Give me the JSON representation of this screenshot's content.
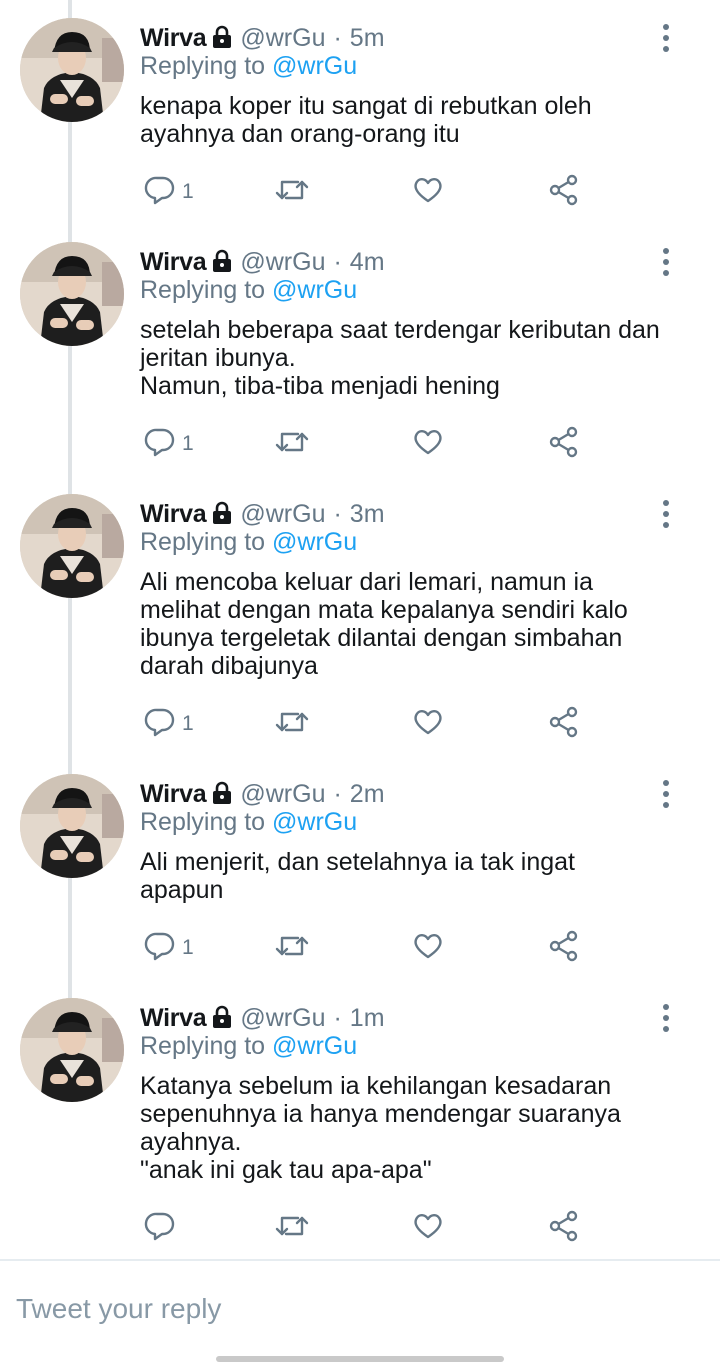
{
  "colors": {
    "accent": "#1da1f2",
    "secondary": "#657786",
    "text": "#14171a",
    "thread_line": "#dfe3e6"
  },
  "icons": {
    "reply": "speech-bubble",
    "retweet": "retweet-arrows",
    "like": "heart",
    "share": "share-nodes",
    "more": "vertical-dots",
    "protected": "lock"
  },
  "tweets": [
    {
      "name": "Wirva",
      "handle": "@wrGu",
      "separator": "·",
      "time": "5m",
      "replying_prefix": "Replying to",
      "replying_to": "@wrGu",
      "text": "kenapa koper itu sangat di rebutkan oleh\nayahnya dan orang-orang itu",
      "reply_count": "1"
    },
    {
      "name": "Wirva",
      "handle": "@wrGu",
      "separator": "·",
      "time": "4m",
      "replying_prefix": "Replying to",
      "replying_to": "@wrGu",
      "text": "setelah beberapa saat terdengar keributan dan\njeritan ibunya.\nNamun, tiba-tiba menjadi hening",
      "reply_count": "1"
    },
    {
      "name": "Wirva",
      "handle": "@wrGu",
      "separator": "·",
      "time": "3m",
      "replying_prefix": "Replying to",
      "replying_to": "@wrGu",
      "text": "Ali mencoba keluar dari lemari, namun ia\nmelihat dengan mata kepalanya sendiri kalo\nibunya tergeletak dilantai dengan simbahan\ndarah dibajunya",
      "reply_count": "1"
    },
    {
      "name": "Wirva",
      "handle": "@wrGu",
      "separator": "·",
      "time": "2m",
      "replying_prefix": "Replying to",
      "replying_to": "@wrGu",
      "text": "Ali menjerit, dan setelahnya ia tak ingat\napapun",
      "reply_count": "1"
    },
    {
      "name": "Wirva",
      "handle": "@wrGu",
      "separator": "·",
      "time": "1m",
      "replying_prefix": "Replying to",
      "replying_to": "@wrGu",
      "text": "Katanya sebelum ia kehilangan kesadaran\nsepenuhnya ia hanya mendengar suaranya\nayahnya.\n\"anak ini gak tau apa-apa\"",
      "reply_count": ""
    }
  ],
  "composer": {
    "placeholder": "Tweet your reply"
  }
}
